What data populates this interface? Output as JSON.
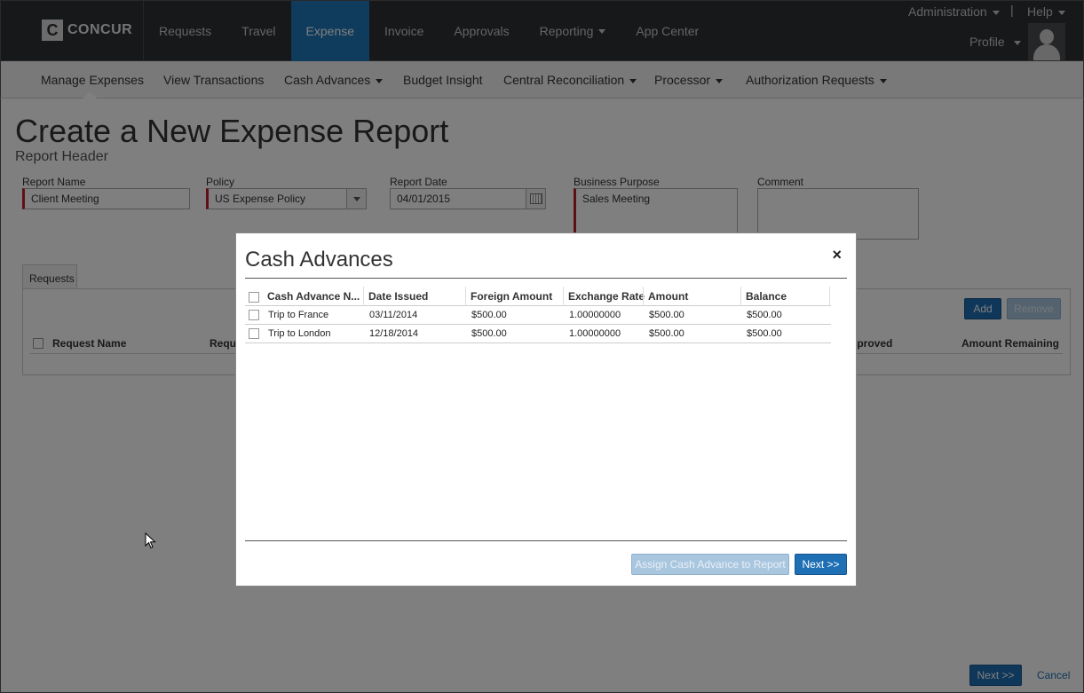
{
  "top_nav": {
    "logo_letter": "C",
    "logo_text": "CONCUR",
    "items": [
      "Requests",
      "Travel",
      "Expense",
      "Invoice",
      "Approvals",
      "Reporting",
      "App Center"
    ],
    "active_item": "Expense",
    "administration": "Administration",
    "separator": "|",
    "help": "Help",
    "profile": "Profile"
  },
  "sub_nav": {
    "items": [
      "Manage Expenses",
      "View Transactions",
      "Cash Advances",
      "Budget Insight",
      "Central Reconciliation",
      "Processor",
      "Authorization Requests"
    ]
  },
  "page": {
    "title": "Create a New Expense Report",
    "subtitle": "Report Header",
    "fields": {
      "report_name_label": "Report Name",
      "report_name_value": "Client Meeting",
      "policy_label": "Policy",
      "policy_value": "US Expense Policy",
      "report_date_label": "Report Date",
      "report_date_value": "04/01/2015",
      "business_purpose_label": "Business Purpose",
      "business_purpose_value": "Sales Meeting",
      "comment_label": "Comment",
      "comment_value": ""
    },
    "requests_tab": "Requests",
    "add_button": "Add",
    "remove_button": "Remove",
    "request_columns": [
      "Request Name",
      "Requ",
      "pproved",
      "Amount Remaining"
    ],
    "footer_next": "Next >>",
    "footer_cancel": "Cancel"
  },
  "modal": {
    "title": "Cash Advances",
    "close": "×",
    "columns": [
      "Cash Advance N...",
      "Date Issued",
      "Foreign Amount",
      "Exchange Rate",
      "Amount",
      "Balance"
    ],
    "rows": [
      {
        "name": "Trip to France",
        "date_issued": "03/11/2014",
        "foreign_amount": "$500.00",
        "exchange_rate": "1.00000000",
        "amount": "$500.00",
        "balance": "$500.00"
      },
      {
        "name": "Trip to London",
        "date_issued": "12/18/2014",
        "foreign_amount": "$500.00",
        "exchange_rate": "1.00000000",
        "amount": "$500.00",
        "balance": "$500.00"
      }
    ],
    "assign_button": "Assign Cash Advance to Report",
    "next_button": "Next >>"
  },
  "colors": {
    "nav_bg": "#2e3134",
    "accent_blue": "#1f76b8",
    "required_red": "#c01e2e"
  }
}
